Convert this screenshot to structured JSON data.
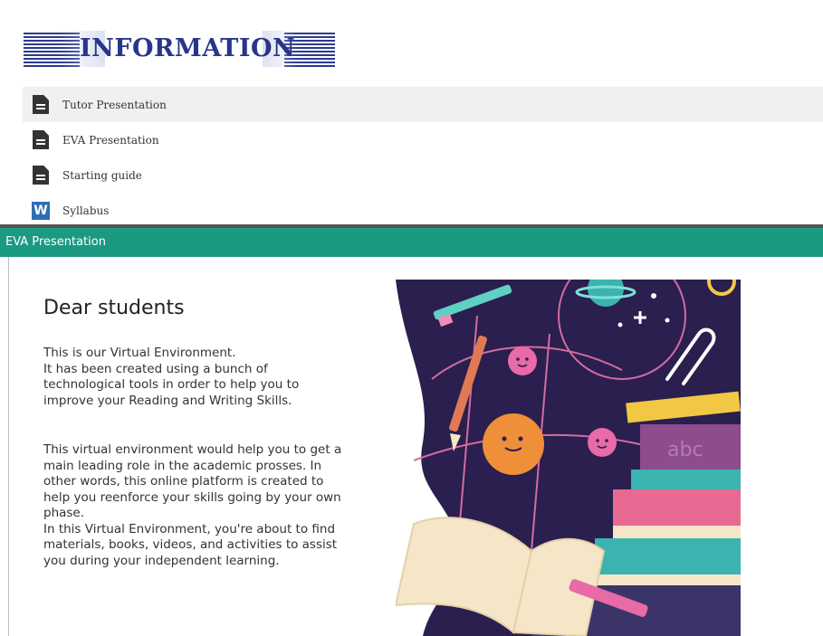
{
  "banner": {
    "title": "INFORMATION"
  },
  "resources": [
    {
      "label": "Tutor Presentation",
      "icon": "document-icon"
    },
    {
      "label": "EVA Presentation",
      "icon": "document-icon"
    },
    {
      "label": "Starting guide",
      "icon": "document-icon"
    },
    {
      "label": "Syllabus",
      "icon": "word-icon",
      "icon_text": "W"
    }
  ],
  "panel": {
    "header": "EVA Presentation",
    "heading": "Dear students",
    "paragraph1": [
      "This is our Virtual Environment.",
      "It has been created using a bunch of",
      "technological tools in order to help you to",
      "improve your Reading and Writing Skills."
    ],
    "paragraph2": [
      "This virtual environment would help you to get a",
      "main leading role in the academic prosses. In",
      "other words, this online platform is created to",
      "help you reenforce your skills going by your own",
      "phase.",
      "In this Virtual Environment, you're about to find",
      "materials, books, videos, and activities to assist",
      "you during your independent learning."
    ],
    "illustration_text": "abc"
  },
  "colors": {
    "banner_blue": "#27358a",
    "header_teal": "#1b9a82",
    "word_blue": "#2d6db5",
    "illus_bg": "#2a1f4e"
  }
}
